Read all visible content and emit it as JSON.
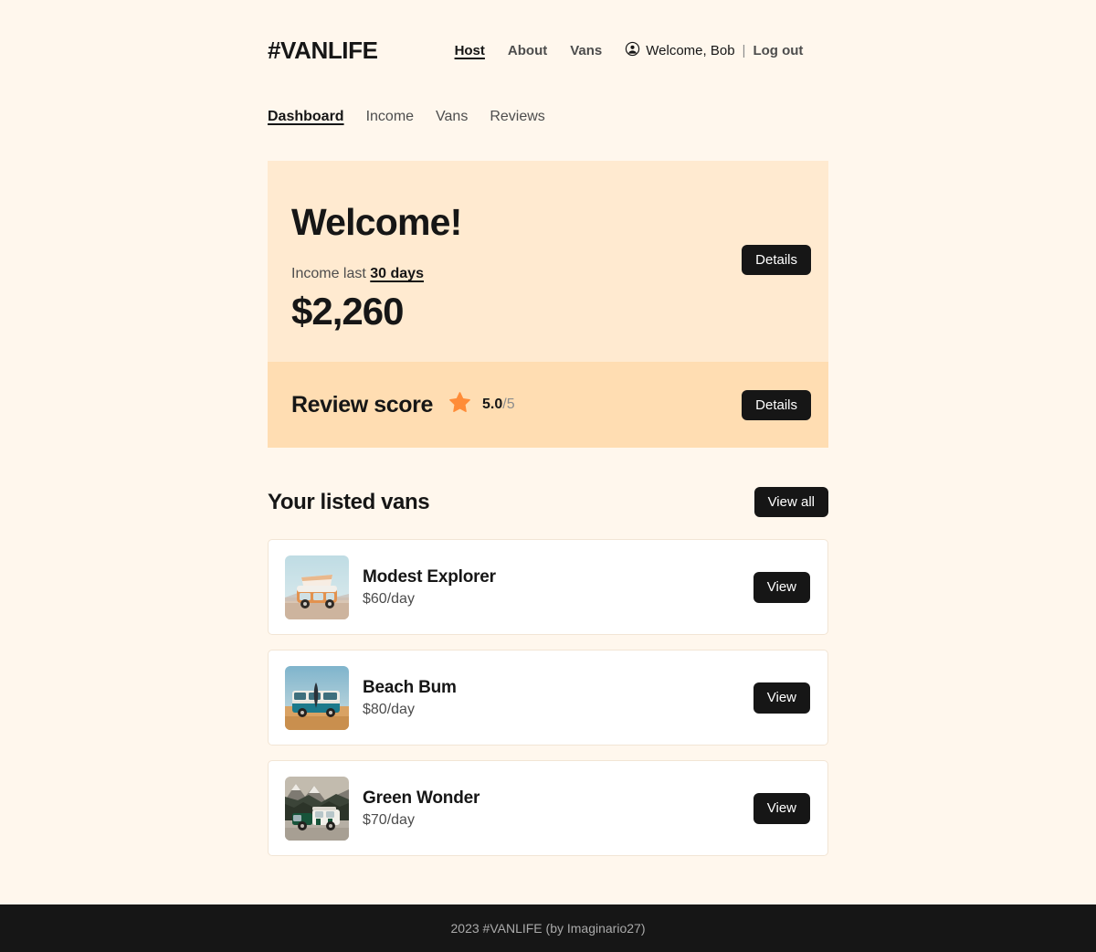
{
  "header": {
    "brand": "#VANLIFE",
    "nav": [
      {
        "label": "Host",
        "active": true
      },
      {
        "label": "About",
        "active": false
      },
      {
        "label": "Vans",
        "active": false
      }
    ],
    "user_icon": "account-circle-icon",
    "welcome": "Welcome, Bob",
    "separator": "|",
    "logout": "Log out"
  },
  "host_nav": [
    {
      "label": "Dashboard",
      "active": true
    },
    {
      "label": "Income",
      "active": false
    },
    {
      "label": "Vans",
      "active": false
    },
    {
      "label": "Reviews",
      "active": false
    }
  ],
  "dashboard": {
    "welcome_heading": "Welcome!",
    "income_label_prefix": "Income last ",
    "income_period": "30 days",
    "income_amount": "$2,260",
    "income_details_label": "Details",
    "review_title": "Review score",
    "review_star_icon": "star-icon",
    "review_score": "5.0",
    "review_max": "/5",
    "review_details_label": "Details"
  },
  "vans_section": {
    "title": "Your listed vans",
    "view_all_label": "View all",
    "vans": [
      {
        "name": "Modest Explorer",
        "price": "$60/day",
        "view_label": "View",
        "thumb": "orange-van-desert"
      },
      {
        "name": "Beach Bum",
        "price": "$80/day",
        "view_label": "View",
        "thumb": "teal-van-beach"
      },
      {
        "name": "Green Wonder",
        "price": "$70/day",
        "view_label": "View",
        "thumb": "green-van-mountains"
      }
    ]
  },
  "footer": {
    "text": "2023 #VANLIFE (by Imaginario27)"
  },
  "colors": {
    "page_bg": "#FFF7ED",
    "income_panel": "#FFEAD0",
    "review_panel": "#FFDDB2",
    "dark": "#161616",
    "star": "#FF8C38"
  }
}
